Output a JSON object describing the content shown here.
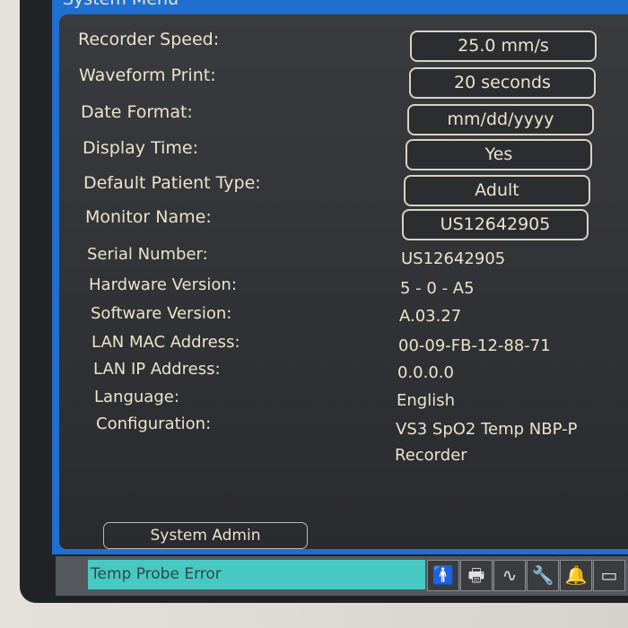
{
  "title": "System Menu",
  "settings": [
    {
      "label": "Recorder Speed:",
      "value": "25.0 mm/s"
    },
    {
      "label": "Waveform Print:",
      "value": "20 seconds"
    },
    {
      "label": "Date Format:",
      "value": "mm/dd/yyyy"
    },
    {
      "label": "Display Time:",
      "value": "Yes"
    },
    {
      "label": "Default Patient Type:",
      "value": "Adult"
    },
    {
      "label": "Monitor Name:",
      "value": "US12642905"
    }
  ],
  "info": [
    {
      "label": "Serial Number:",
      "value": "US12642905"
    },
    {
      "label": "Hardware Version:",
      "value": "5 - 0 - A5"
    },
    {
      "label": "Software Version:",
      "value": "A.03.27"
    },
    {
      "label": "LAN MAC Address:",
      "value": "00-09-FB-12-88-71"
    },
    {
      "label": "LAN IP Address:",
      "value": "0.0.0.0"
    },
    {
      "label": "Language:",
      "value": "English"
    },
    {
      "label": "Configuration:",
      "value": "VS3 SpO2 Temp NBP-P"
    }
  ],
  "config_line2": "Recorder",
  "system_admin": "System Admin",
  "status_message": "Temp Probe Error",
  "status_icons": [
    "patient-icon",
    "printer-icon",
    "waveform-icon",
    "wrench-icon",
    "bell-icon",
    "battery-icon"
  ],
  "colors": {
    "frame": "#1f6fd0",
    "status": "#48c8c2"
  }
}
